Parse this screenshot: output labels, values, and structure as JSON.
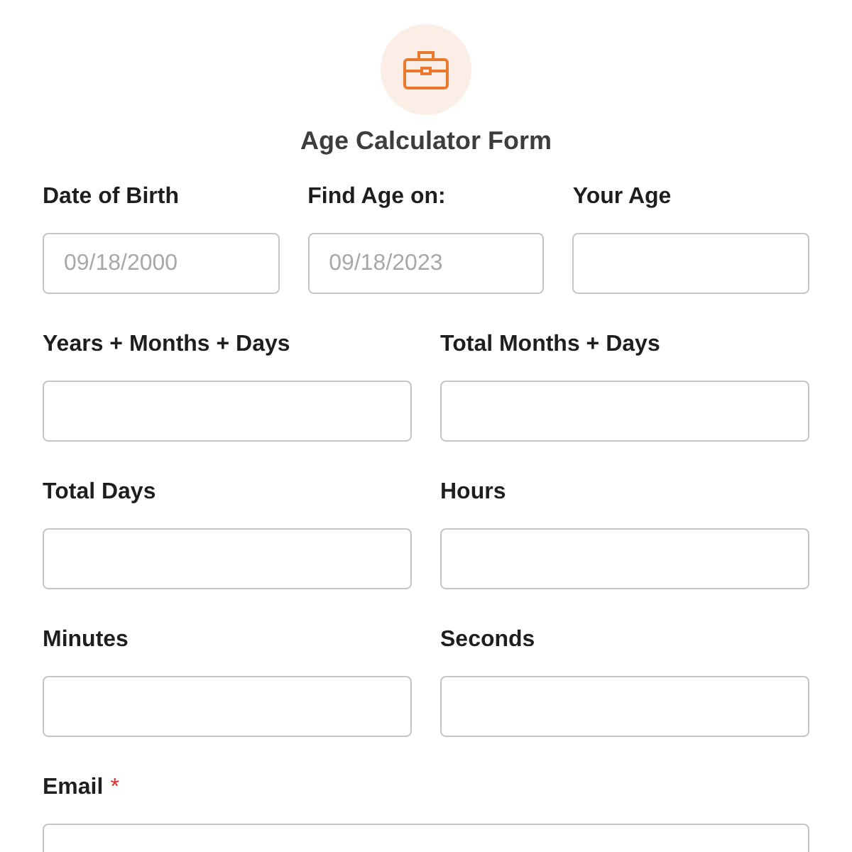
{
  "form": {
    "title": "Age Calculator Form"
  },
  "rows": [
    {
      "fields": [
        {
          "label": "Date of Birth",
          "placeholder": "09/18/2000"
        },
        {
          "label": "Find Age on:",
          "placeholder": "09/18/2023"
        },
        {
          "label": "Your Age"
        }
      ]
    },
    {
      "fields": [
        {
          "label": "Years + Months + Days"
        },
        {
          "label": "Total Months + Days"
        }
      ]
    },
    {
      "fields": [
        {
          "label": "Total Days"
        },
        {
          "label": "Hours"
        }
      ]
    },
    {
      "fields": [
        {
          "label": "Minutes"
        },
        {
          "label": "Seconds"
        }
      ]
    },
    {
      "fields": [
        {
          "label": "Email",
          "required_mark": "*"
        }
      ]
    }
  ]
}
